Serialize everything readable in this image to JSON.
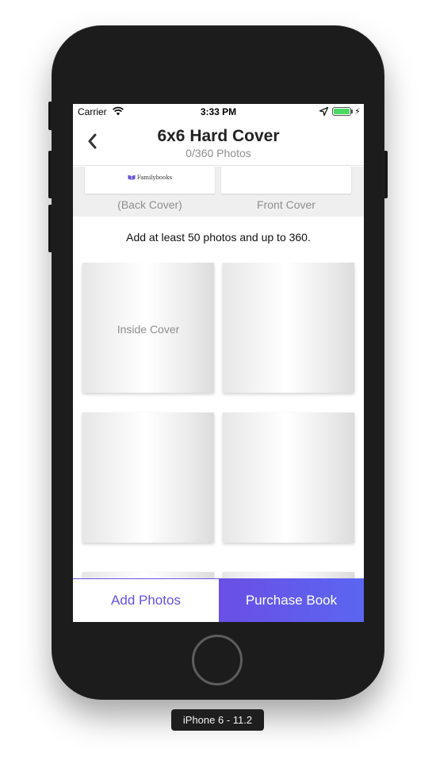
{
  "device": {
    "label": "iPhone 6 - 11.2"
  },
  "status_bar": {
    "carrier": "Carrier",
    "time": "3:33 PM",
    "battery_level": 1.0,
    "battery_color": "#4cd964"
  },
  "nav": {
    "title": "6x6 Hard Cover",
    "subtitle": "0/360 Photos",
    "back_icon": "chevron-left-icon"
  },
  "covers": {
    "brand": "Familybooks",
    "back_label": "(Back Cover)",
    "front_label": "Front Cover"
  },
  "instructions": "Add at least 50 photos and up to 360.",
  "pages": [
    {
      "label": "Inside Cover"
    },
    {
      "label": ""
    },
    {
      "label": ""
    },
    {
      "label": ""
    },
    {
      "label": ""
    },
    {
      "label": ""
    }
  ],
  "actions": {
    "add_photos": "Add Photos",
    "purchase": "Purchase Book"
  },
  "colors": {
    "accent": "#6a4fe5",
    "accent_end": "#5b66f0"
  }
}
